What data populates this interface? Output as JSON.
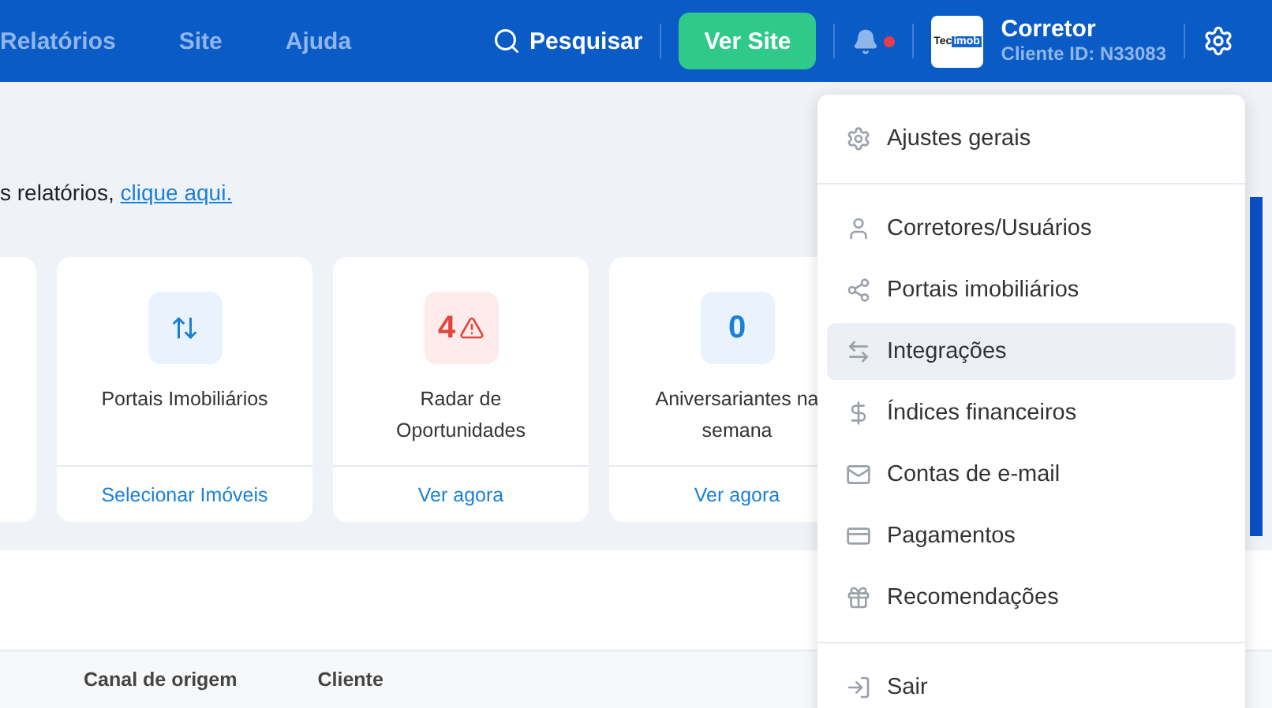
{
  "nav": {
    "links": [
      "Relatórios",
      "Site",
      "Ajuda"
    ],
    "search": "Pesquisar",
    "site_button": "Ver Site",
    "notifications": {
      "unread": true
    },
    "logo": {
      "part_1": "Tec",
      "part_2": "imob"
    },
    "user": {
      "name": "Corretor",
      "client_id": "Cliente ID: N33083"
    }
  },
  "notice": {
    "text": "s relatórios, ",
    "link": "clique aqui."
  },
  "cards": [
    {
      "kind": "blank"
    },
    {
      "kind": "icon",
      "label": "Portais Imobiliários",
      "action": "Selecionar Imóveis"
    },
    {
      "kind": "alert",
      "badge": "4",
      "label": "Radar de Oportunidades",
      "action": "Ver agora"
    },
    {
      "kind": "count",
      "badge": "0",
      "label": "Aniversariantes na semana",
      "action": "Ver agora"
    }
  ],
  "table": {
    "columns": [
      "Canal de origem",
      "Cliente"
    ]
  },
  "settings_menu": {
    "groups": [
      {
        "items": [
          {
            "label": "Ajustes gerais",
            "highlighted": false
          }
        ]
      },
      {
        "items": [
          {
            "label": "Corretores/Usuários",
            "highlighted": false
          },
          {
            "label": "Portais imobiliários",
            "highlighted": false
          },
          {
            "label": "Integrações",
            "highlighted": true
          },
          {
            "label": "Índices financeiros",
            "highlighted": false
          },
          {
            "label": "Contas de e-mail",
            "highlighted": false
          },
          {
            "label": "Pagamentos",
            "highlighted": false
          },
          {
            "label": "Recomendações",
            "highlighted": false
          }
        ]
      },
      {
        "items": [
          {
            "label": "Sair",
            "highlighted": false
          }
        ]
      }
    ]
  }
}
